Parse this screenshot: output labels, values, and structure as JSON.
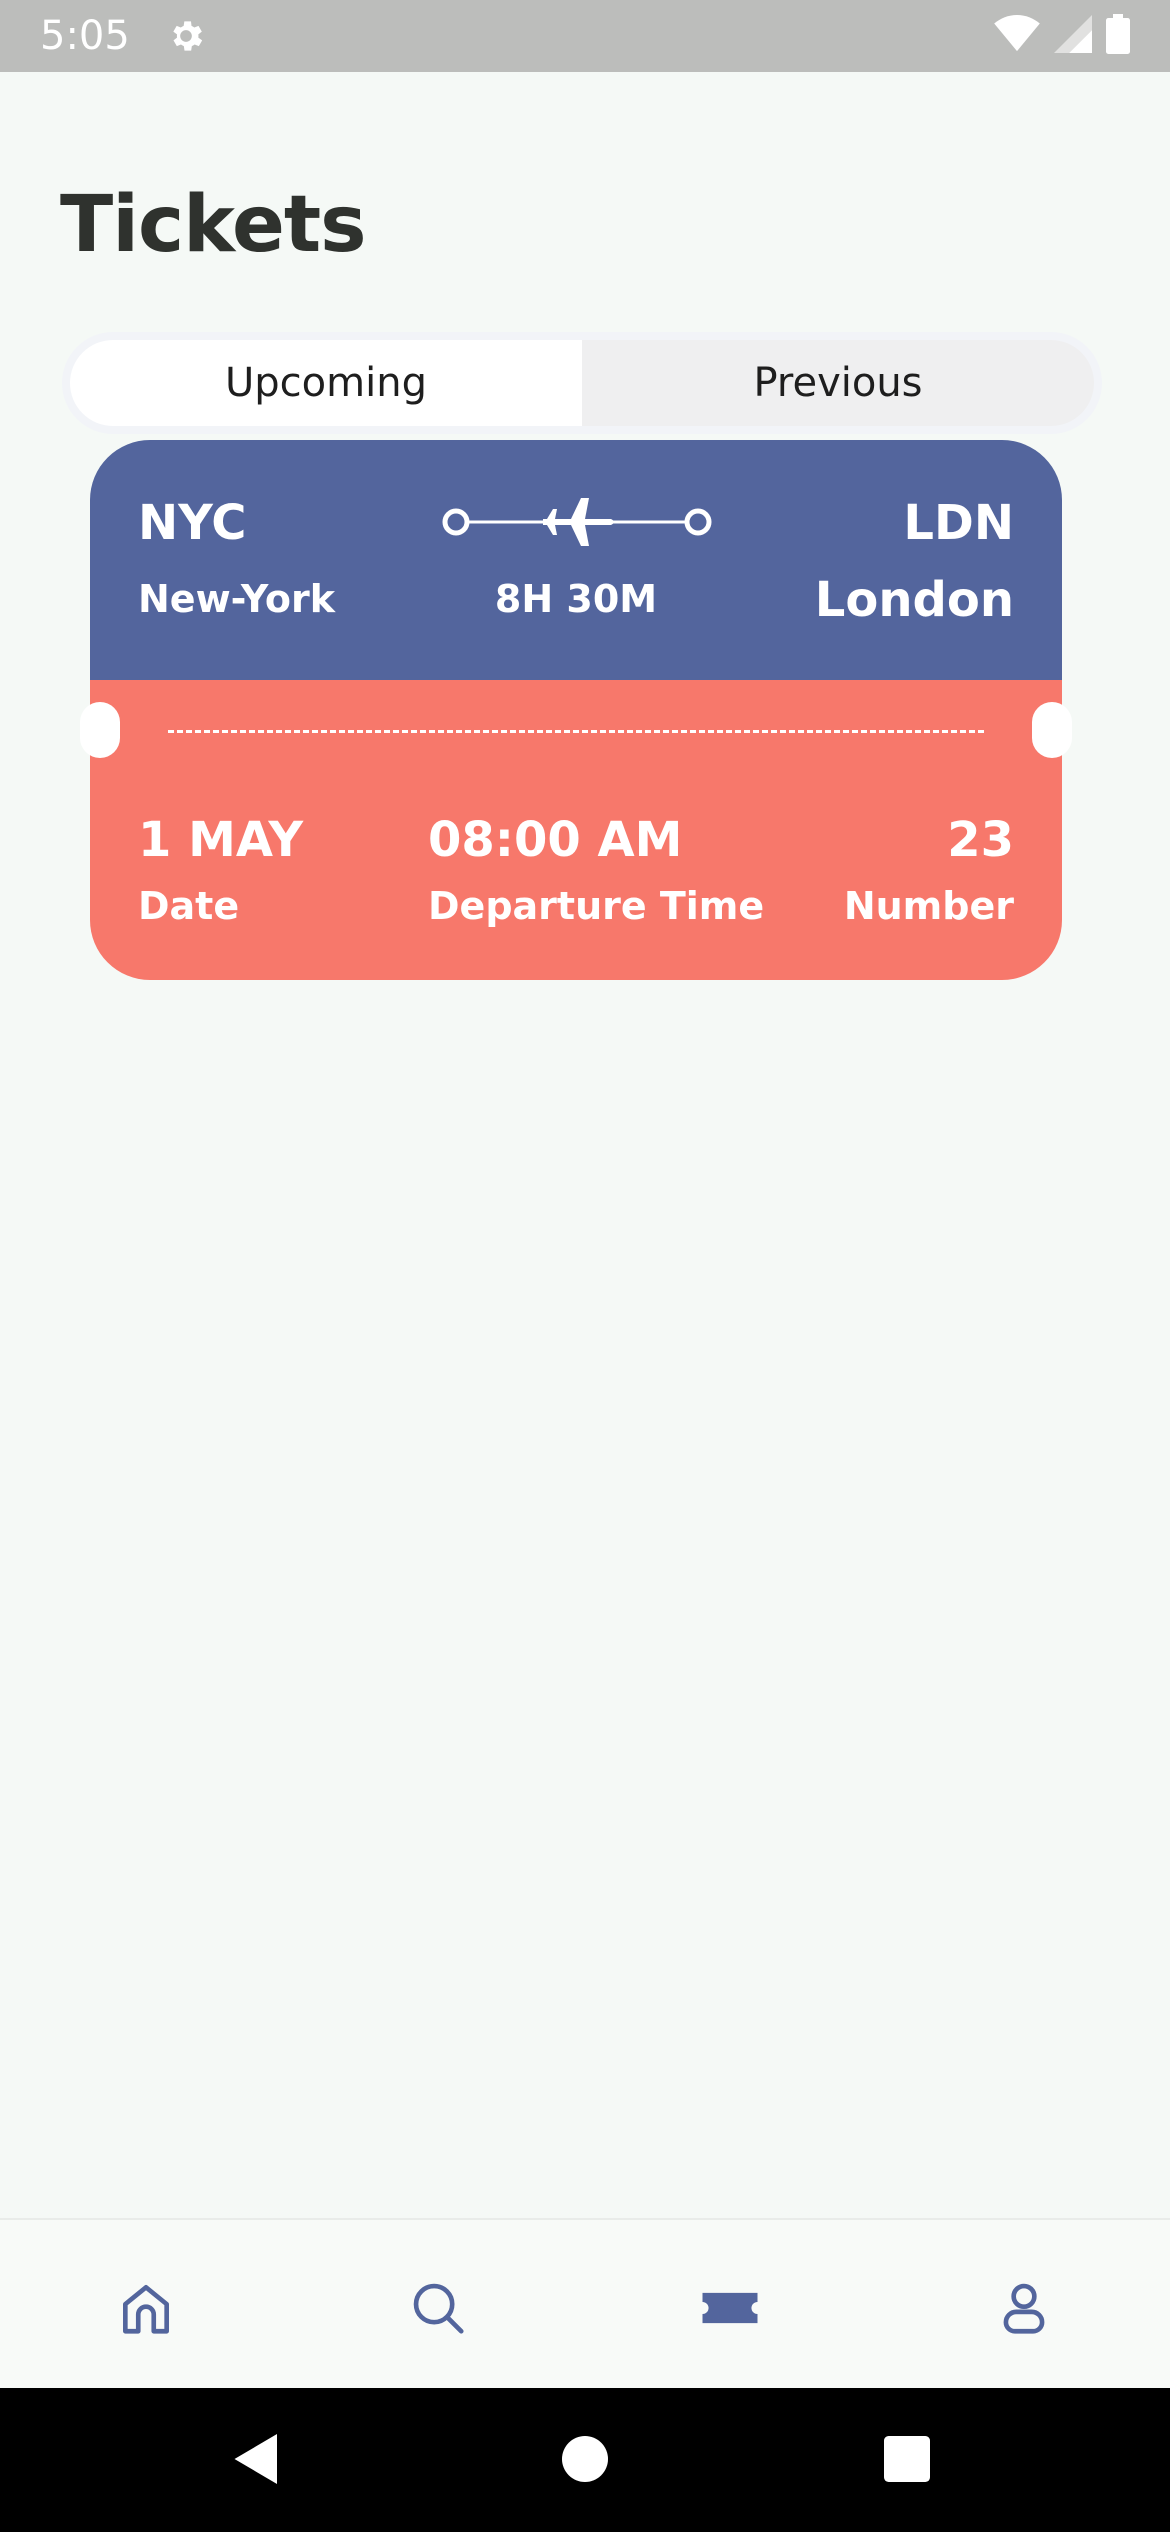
{
  "status_bar": {
    "time": "5:05",
    "icons": [
      "settings-gear-icon",
      "wifi-icon",
      "cellular-signal-icon",
      "battery-icon"
    ]
  },
  "page": {
    "title": "Tickets"
  },
  "tabs": [
    {
      "label": "Upcoming",
      "selected": true
    },
    {
      "label": "Previous",
      "selected": false
    }
  ],
  "ticket": {
    "origin_code": "NYC",
    "origin_city": "New-York",
    "destination_code": "LDN",
    "destination_city": "London",
    "duration": "8H 30M",
    "date": "1 MAY",
    "date_label": "Date",
    "departure_time": "08:00 AM",
    "departure_label": "Departure Time",
    "number": "23",
    "number_label": "Number",
    "colors": {
      "top": "#53659d",
      "bottom": "#f7786b"
    }
  },
  "bottom_nav": {
    "items": [
      {
        "icon": "home-icon",
        "active": false
      },
      {
        "icon": "search-icon",
        "active": false
      },
      {
        "icon": "ticket-icon",
        "active": true
      },
      {
        "icon": "profile-icon",
        "active": false
      }
    ],
    "color": "#53659d"
  },
  "system_nav": {
    "icons": [
      "back-icon",
      "home-circle-icon",
      "recents-icon"
    ]
  }
}
